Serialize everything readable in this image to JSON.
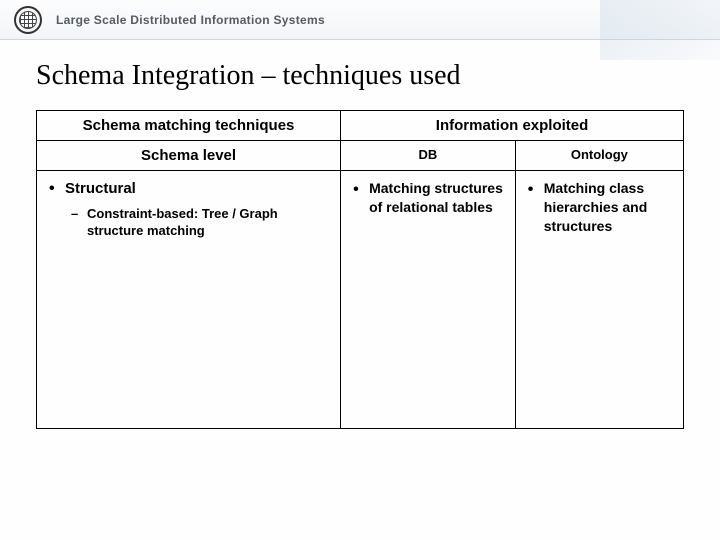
{
  "header": {
    "brand": "Large Scale Distributed Information Systems"
  },
  "title": "Schema Integration – techniques used",
  "table": {
    "head": {
      "techniques": "Schema matching techniques",
      "info": "Information exploited",
      "level": "Schema level",
      "db": "DB",
      "ontology": "Ontology"
    },
    "row": {
      "technique": "Structural",
      "technique_sub": "Constraint-based: Tree / Graph structure matching",
      "db_item": "Matching structures of relational tables",
      "ont_item": "Matching class hierarchies and structures"
    }
  }
}
